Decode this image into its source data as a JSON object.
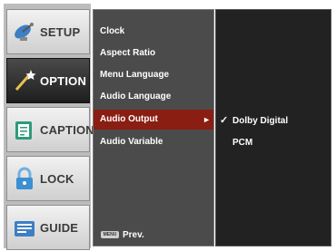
{
  "tabs": [
    {
      "label": "SETUP",
      "icon": "satellite-dish-icon",
      "active": false
    },
    {
      "label": "OPTION",
      "icon": "magic-wand-icon",
      "active": true
    },
    {
      "label": "CAPTION",
      "icon": "caption-book-icon",
      "active": false
    },
    {
      "label": "LOCK",
      "icon": "padlock-icon",
      "active": false
    },
    {
      "label": "GUIDE",
      "icon": "guide-folder-icon",
      "active": false
    }
  ],
  "menu": {
    "items": [
      {
        "label": "Clock"
      },
      {
        "label": "Aspect Ratio"
      },
      {
        "label": "Menu Language"
      },
      {
        "label": "Audio Language"
      },
      {
        "label": "Audio Output",
        "selected": true
      },
      {
        "label": "Audio Variable"
      }
    ],
    "arrow": "►",
    "menu_key_label": "MENU",
    "prev_label": "Prev."
  },
  "submenu": {
    "items": [
      {
        "label": "Dolby Digital",
        "checked": true
      },
      {
        "label": "PCM",
        "checked": false
      }
    ],
    "check_glyph": "✓"
  },
  "colors": {
    "selected_item": "#8a1e12",
    "menu_panel": "#4b4b4b",
    "submenu_panel": "#222222",
    "active_tab": "#1e1e1e"
  }
}
